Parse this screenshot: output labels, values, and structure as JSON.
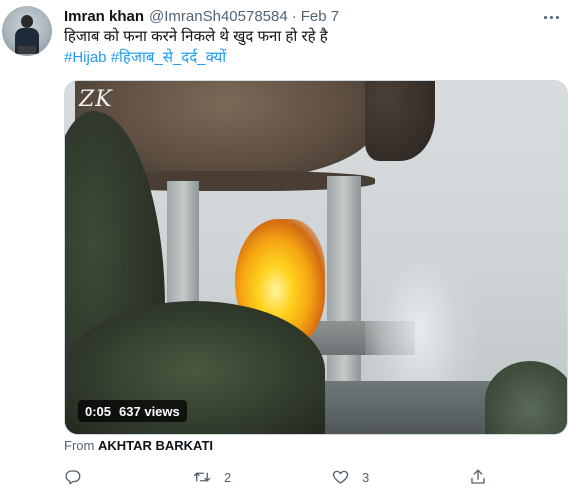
{
  "tweet": {
    "author_name": "Imran khan",
    "handle": "@ImranSh40578584",
    "separator": "·",
    "date": "Feb 7",
    "text": "हिजाब को फना करने निकले थे खुद फना हो रहे है",
    "hashtags": [
      "#Hijab",
      "#हिजाब_से_दर्द_क्यों"
    ]
  },
  "media": {
    "watermark": "ZK",
    "duration": "0:05",
    "views": "637 views",
    "description_colors": {
      "fire": "#f5a412",
      "smoke": "#e6e9eb"
    }
  },
  "source": {
    "prefix": "From",
    "name": "AKHTAR BARKATI"
  },
  "actions": {
    "reply": {
      "icon": "reply-icon",
      "count": ""
    },
    "retweet": {
      "icon": "retweet-icon",
      "count": "2"
    },
    "like": {
      "icon": "heart-icon",
      "count": "3"
    },
    "share": {
      "icon": "share-icon",
      "count": ""
    }
  },
  "colors": {
    "link": "#1d9bf0",
    "secondary_text": "#536471",
    "primary_text": "#0f1419"
  }
}
